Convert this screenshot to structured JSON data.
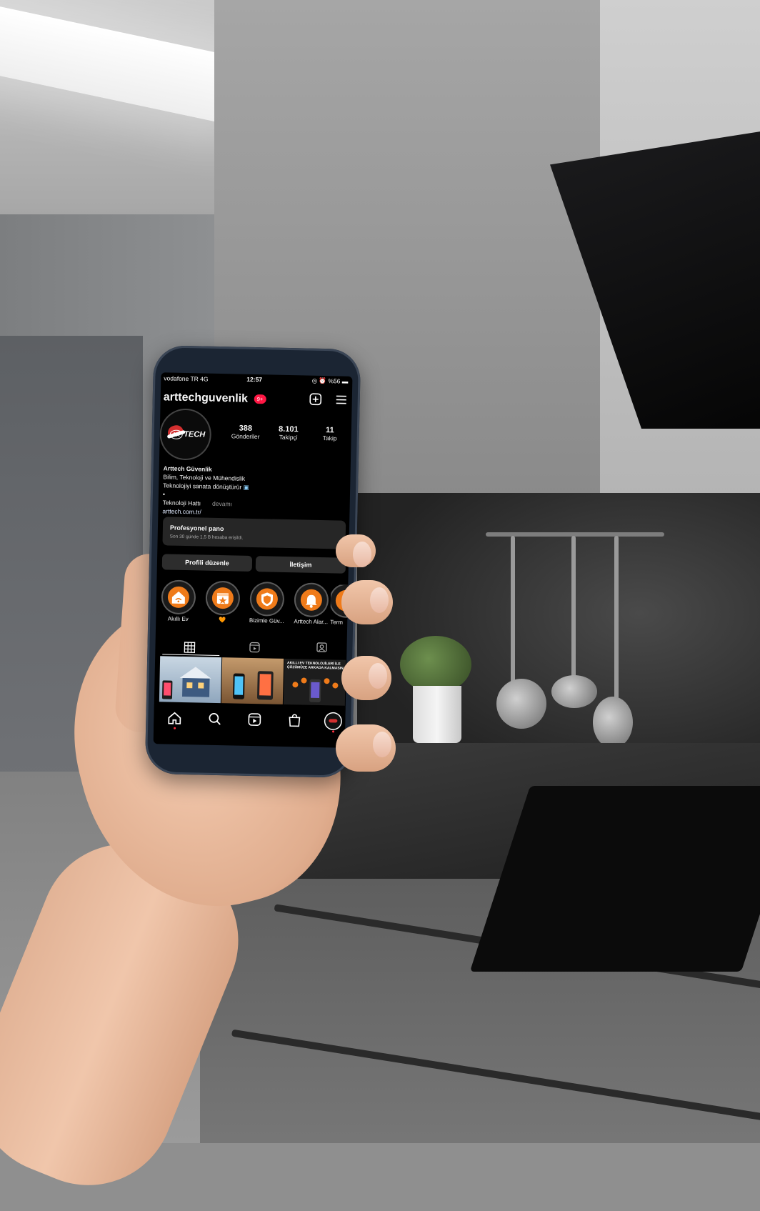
{
  "status_bar": {
    "carrier": "vodafone TR  4G",
    "time": "12:57",
    "battery": "%56"
  },
  "profile": {
    "username": "arttechguvenlik",
    "notification_badge": "9+",
    "avatar_text": "TECH",
    "avatar_letters": "AR",
    "stats": [
      {
        "value": "388",
        "label": "Gönderiler"
      },
      {
        "value": "8.101",
        "label": "Takipçi"
      },
      {
        "value": "11",
        "label": "Takip"
      }
    ],
    "bio": {
      "name": "Arttech Güvenlik",
      "line1": "Bilim, Teknoloji ve Mühendislik",
      "line2": "Teknolojiyi sanata dönüştürür",
      "line3": "▪",
      "line4": "Teknoloji Hattı",
      "more": "devamı",
      "link": "arttech.com.tr/"
    }
  },
  "pro_dashboard": {
    "title": "Profesyonel pano",
    "subtitle": "Son 30 günde 1,5 B hesaba erişildi."
  },
  "buttons": {
    "edit_profile": "Profili düzenle",
    "contact": "İletişim"
  },
  "highlights": [
    {
      "label": "Akıllı Ev",
      "icon": "smart-home-icon"
    },
    {
      "label": "🧡",
      "icon": "calendar-star-icon"
    },
    {
      "label": "Bizimle Güv...",
      "icon": "shield-icon"
    },
    {
      "label": "Arttech Alar...",
      "icon": "bell-icon"
    },
    {
      "label": "Term",
      "icon": "partial-icon"
    }
  ],
  "posts": {
    "tile3_caption": "AKILLI EV TEKNOLOJİLERİ İLE\nÇÖZÜMÜZE ARKADA KALMASIN"
  },
  "colors": {
    "accent_orange": "#ef7b1a",
    "badge_red": "#ff1744",
    "screen_bg": "#000000"
  }
}
